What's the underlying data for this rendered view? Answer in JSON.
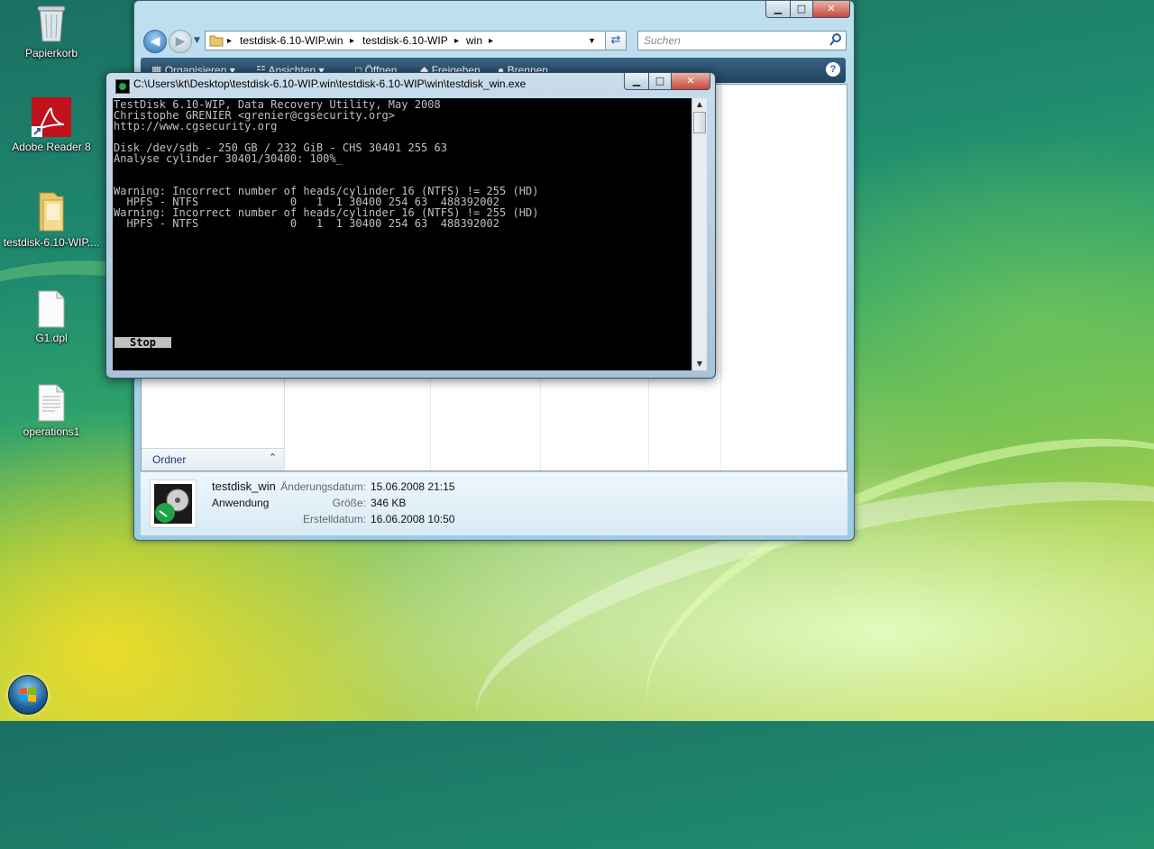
{
  "desktop": {
    "icons": [
      {
        "label": "Papierkorb",
        "icon": "recycle-bin-icon"
      },
      {
        "label": "Adobe Reader 8",
        "icon": "adobe-reader-icon"
      },
      {
        "label": "testdisk-6.10-WIP....",
        "icon": "folder-icon"
      },
      {
        "label": "G1.dpl",
        "icon": "document-icon"
      },
      {
        "label": "operations1",
        "icon": "text-file-icon"
      }
    ]
  },
  "explorer": {
    "caption_buttons": {
      "minimize": "▁",
      "maximize": "□",
      "close": "✕"
    },
    "breadcrumb": [
      "testdisk-6.10-WIP.win",
      "testdisk-6.10-WIP",
      "win"
    ],
    "breadcrumb_sep": "▸",
    "search_placeholder": "Suchen",
    "toolbar": {
      "organize": "Organisieren",
      "views": "Ansichten",
      "open": "Öffnen",
      "share": "Freigeben",
      "burn": "Brennen"
    },
    "folders_label": "Ordner",
    "details": {
      "name": "testdisk_win",
      "type": "Anwendung",
      "modified_label": "Änderungsdatum:",
      "modified_value": "15.06.2008 21:15",
      "size_label": "Größe:",
      "size_value": "346 KB",
      "created_label": "Erstelldatum:",
      "created_value": "16.06.2008 10:50"
    }
  },
  "console": {
    "title": "C:\\Users\\kt\\Desktop\\testdisk-6.10-WIP.win\\testdisk-6.10-WIP\\win\\testdisk_win.exe",
    "caption_buttons": {
      "minimize": "▁",
      "maximize": "□",
      "close": "✕"
    },
    "lines": [
      "TestDisk 6.10-WIP, Data Recovery Utility, May 2008",
      "Christophe GRENIER <grenier@cgsecurity.org>",
      "http://www.cgsecurity.org",
      "",
      "Disk /dev/sdb - 250 GB / 232 GiB - CHS 30401 255 63",
      "Analyse cylinder 30401/30400: 100%_",
      "",
      "",
      "Warning: Incorrect number of heads/cylinder 16 (NTFS) != 255 (HD)",
      "  HPFS - NTFS              0   1  1 30400 254 63  488392002",
      "Warning: Incorrect number of heads/cylinder 16 (NTFS) != 255 (HD)",
      "  HPFS - NTFS              0   1  1 30400 254 63  488392002"
    ],
    "stop_label": "Stop"
  }
}
